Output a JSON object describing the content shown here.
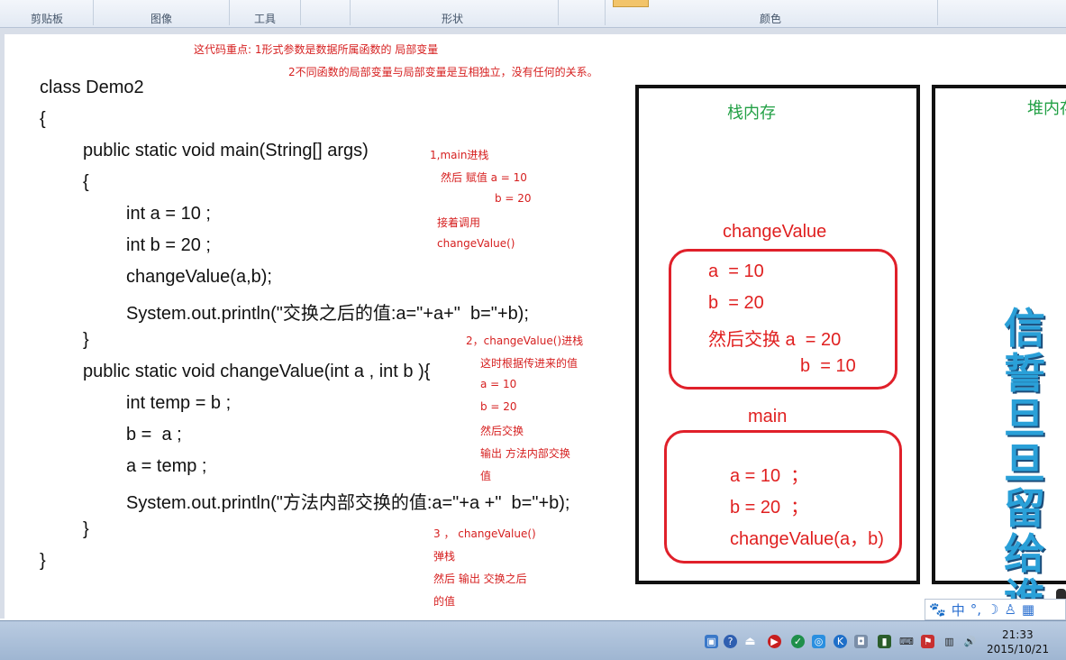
{
  "ribbon": {
    "groups": [
      "剪贴板",
      "图像",
      "工具",
      "形状",
      "颜色"
    ]
  },
  "notes": {
    "top1": "这代码重点: 1形式参数是数据所属函数的 局部变量",
    "top2": "2不同函数的局部变量与局部变量是互相独立，没有任何的关系。",
    "step1": [
      "1,main进栈",
      "然后 赋值 a = 10",
      "b = 20",
      "接着调用",
      "changeValue()"
    ],
    "step2": [
      "2，changeValue()进栈",
      "这时根据传进来的值",
      "a = 10",
      "b = 20",
      "然后交换",
      "输出 方法内部交换",
      "值"
    ],
    "step3": [
      "3 ， changeValue()",
      "弹栈",
      "然后 输出 交换之后",
      "的值"
    ]
  },
  "code": [
    "class Demo2",
    "{",
    "public static void main(String[] args)",
    "{",
    "int a = 10 ;",
    "int b = 20 ;",
    "changeValue(a,b);",
    "System.out.println(\"交换之后的值:a=\"+a+\"  b=\"+b);",
    "}",
    "public static void changeValue(int a , int b ){",
    "int temp = b ;",
    "b =  a ;",
    "a = temp ;",
    "System.out.println(\"方法内部交换的值:a=\"+a +\"  b=\"+b);",
    "}",
    "}"
  ],
  "stack": {
    "title": "栈内存",
    "frame1_label": "changeValue",
    "frame1": [
      "a  = 10",
      "b  = 20",
      "然后交换 a  = 20",
      "b  = 10"
    ],
    "frame2_label": "main",
    "frame2": [
      "a = 10  ；",
      "b = 20  ；",
      "changeValue(a，b)"
    ]
  },
  "heap": {
    "title": "堆内存"
  },
  "watermark": "信誓旦旦留给谁",
  "ime": {
    "lang": "中",
    "punct": "°,",
    "moon": "☽"
  },
  "taskbar": {
    "time": "21:33",
    "date": "2015/10/21"
  },
  "colors": {
    "annotation": "#d62020",
    "stack_text": "#e02020",
    "title_green": "#22a045",
    "watermark": "#2aa0d8"
  }
}
